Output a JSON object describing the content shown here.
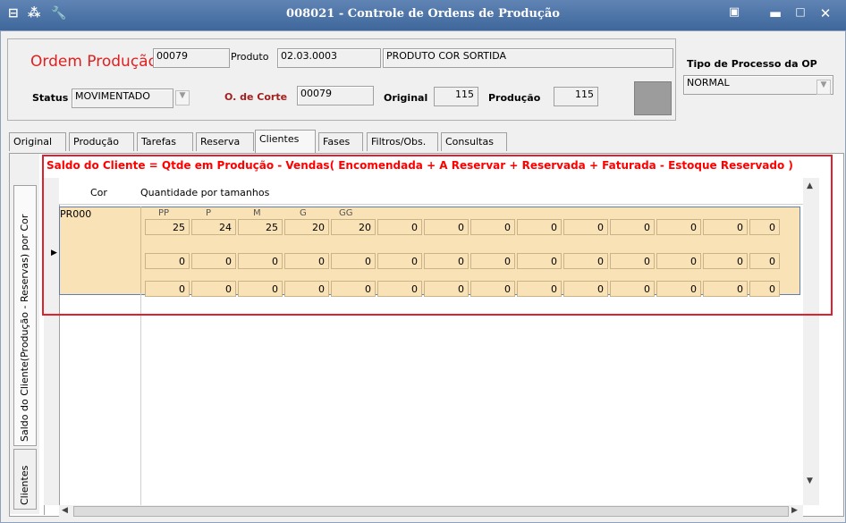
{
  "window": {
    "title": "008021 - Controle de Ordens de Produção"
  },
  "header": {
    "ordem_label": "Ordem Produção",
    "ordem_value": "00079",
    "produto_label": "Produto",
    "produto_code": "02.03.0003",
    "produto_desc": "PRODUTO COR SORTIDA",
    "tipo_label": "Tipo de Processo da OP",
    "tipo_value": "NORMAL",
    "status_label": "Status",
    "status_value": "MOVIMENTADO",
    "corte_label": "O. de Corte",
    "corte_value": "00079",
    "original_label": "Original",
    "original_value": "115",
    "producao_label": "Produção",
    "producao_value": "115"
  },
  "tabs": [
    "Original",
    "Produção",
    "Tarefas",
    "Reserva",
    "Clientes",
    "Fases",
    "Filtros/Obs.",
    "Consultas"
  ],
  "active_tab": "Clientes",
  "side_tabs": [
    "Saldo do Cliente(Produção - Reservas) por Cor",
    "Clientes"
  ],
  "warning": "Saldo do Cliente = Qtde em Produção - Vendas( Encomendada + A Reservar + Reservada + Faturada - Estoque Reservado )",
  "grid": {
    "col_cor": "Cor",
    "col_qtd": "Quantidade por tamanhos",
    "row_cor": "PR000",
    "sizes": [
      "PP",
      "P",
      "M",
      "G",
      "GG"
    ],
    "rows": [
      [
        "25",
        "24",
        "25",
        "20",
        "20",
        "0",
        "0",
        "0",
        "0",
        "0",
        "0",
        "0",
        "0",
        "0"
      ],
      [
        "0",
        "0",
        "0",
        "0",
        "0",
        "0",
        "0",
        "0",
        "0",
        "0",
        "0",
        "0",
        "0",
        "0"
      ],
      [
        "0",
        "0",
        "0",
        "0",
        "0",
        "0",
        "0",
        "0",
        "0",
        "0",
        "0",
        "0",
        "0",
        "0"
      ]
    ]
  },
  "colors": {
    "title_bar": "#4a72a8",
    "warning": "#ff0000",
    "row_fill": "#fae2b7",
    "highlight_box": "#e02030"
  }
}
